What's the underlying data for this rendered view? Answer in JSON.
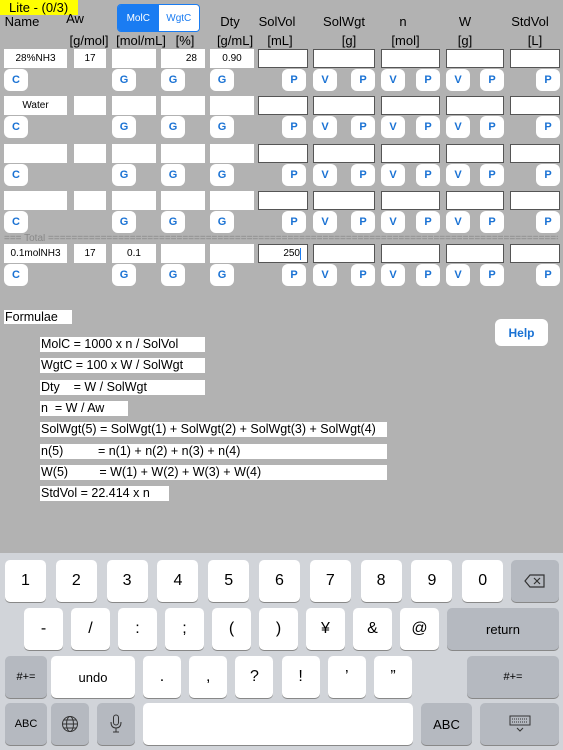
{
  "app": {
    "badge": "Lite - (0/3)",
    "mode_toggle": {
      "options": [
        "MolC",
        "WgtC"
      ],
      "selected": "MolC"
    }
  },
  "columns": [
    {
      "name": "Name",
      "unit": ""
    },
    {
      "name": "Aw",
      "unit": "[g/mol]"
    },
    {
      "name": "",
      "unit": "[mol/mL]"
    },
    {
      "name": "",
      "unit": "[%]"
    },
    {
      "name": "Dty",
      "unit": "[g/mL]"
    },
    {
      "name": "SolVol",
      "unit": "[mL]"
    },
    {
      "name": "SolWgt",
      "unit": "[g]"
    },
    {
      "name": "n",
      "unit": "[mol]"
    },
    {
      "name": "W",
      "unit": "[g]"
    },
    {
      "name": "StdVol",
      "unit": "[L]"
    }
  ],
  "rows": [
    {
      "name": "28%NH3",
      "aw": "17",
      "molc": "",
      "wgtc": "28",
      "dty": "0.90",
      "solvol": "",
      "solwgt": "",
      "n": "",
      "w": "",
      "stdvol": ""
    },
    {
      "name": "Water",
      "aw": "",
      "molc": "",
      "wgtc": "",
      "dty": "",
      "solvol": "",
      "solwgt": "",
      "n": "",
      "w": "",
      "stdvol": ""
    },
    {
      "name": "",
      "aw": "",
      "molc": "",
      "wgtc": "",
      "dty": "",
      "solvol": "",
      "solwgt": "",
      "n": "",
      "w": "",
      "stdvol": ""
    },
    {
      "name": "",
      "aw": "",
      "molc": "",
      "wgtc": "",
      "dty": "",
      "solvol": "",
      "solwgt": "",
      "n": "",
      "w": "",
      "stdvol": ""
    }
  ],
  "total": {
    "separator": "=== Total ==============================================================================================",
    "row": {
      "name": "0.1molNH3",
      "aw": "17",
      "molc": "0.1",
      "wgtc": "",
      "dty": "",
      "solvol": "250",
      "solwgt": "",
      "n": "",
      "w": "",
      "stdvol": ""
    }
  },
  "buttons": {
    "c": "C",
    "g": "G",
    "p": "P",
    "v": "V",
    "help": "Help"
  },
  "formulae": {
    "title": "Formulae",
    "lines": [
      "MolC = 1000 x n / SolVol",
      "WgtC = 100 x W / SolWgt",
      "Dty    = W / SolWgt",
      "n  = W / Aw",
      "SolWgt(5) = SolWgt(1) + SolWgt(2) + SolWgt(3) + SolWgt(4)",
      "n(5)          = n(1) + n(2) + n(3) + n(4)",
      "W(5)         = W(1) + W(2) + W(3) + W(4)",
      "StdVol = 22.414 x n"
    ]
  },
  "keyboard": {
    "row1": [
      "1",
      "2",
      "3",
      "4",
      "5",
      "6",
      "7",
      "8",
      "9",
      "0"
    ],
    "row2": [
      "-",
      "/",
      ":",
      ";",
      "(",
      ")",
      "¥",
      "&",
      "@"
    ],
    "row3": [
      ".",
      ",",
      "?",
      "!",
      "’",
      "”"
    ],
    "return": "return",
    "undo": "undo",
    "symbols": "#+=",
    "abc": "ABC",
    "icons": {
      "delete": "backspace-icon",
      "globe": "globe-icon",
      "mic": "microphone-icon",
      "hide": "keyboard-dismiss-icon"
    }
  }
}
